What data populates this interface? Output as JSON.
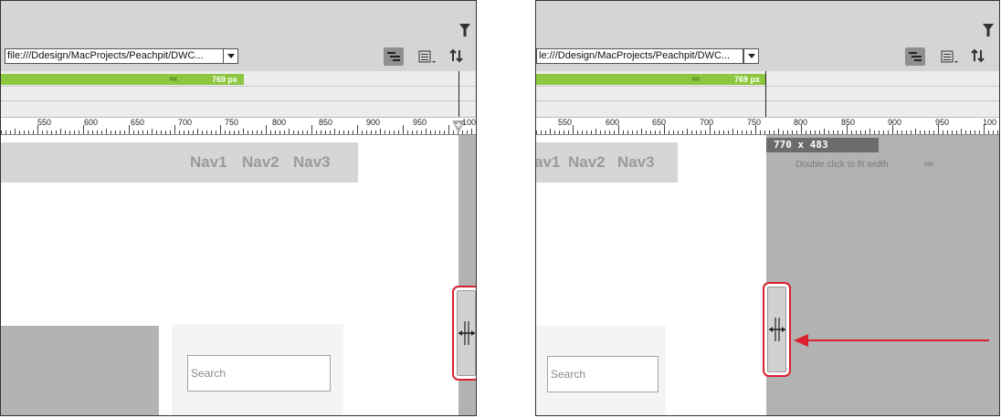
{
  "left": {
    "url": "file:///Ddesign/MacProjects/Peachpit/DWC...",
    "media_query_label": "769 px",
    "media_query_chevrons": "‹‹‹‹‹‹",
    "ruler_numbers": [
      "550",
      "600",
      "650",
      "700",
      "750",
      "800",
      "850",
      "900",
      "950",
      "100"
    ],
    "nav_items": [
      "Nav1",
      "Nav2",
      "Nav3"
    ],
    "search_placeholder": "Search"
  },
  "right": {
    "url": "le:///Ddesign/MacProjects/Peachpit/DWC...",
    "media_query_label": "769 px",
    "media_query_chevrons": "‹‹‹‹‹‹",
    "ruler_numbers": [
      "550",
      "600",
      "650",
      "700",
      "750",
      "800",
      "850",
      "900",
      "950",
      "100"
    ],
    "nav_items": [
      "av1",
      "Nav2",
      "Nav3"
    ],
    "search_placeholder": "Search",
    "size_label": "770 x 483",
    "hint": "Double click to fit width",
    "hint_chevrons": "››››››"
  },
  "icons": [
    "filter-icon",
    "dropdown-arrow-icon",
    "code-navigator-icon",
    "list-view-icon",
    "sort-icon",
    "resize-handle-icon",
    "red-arrow-icon"
  ],
  "colors": {
    "toolbar": "#d5d5d5",
    "media_query_green": "#8dc63f",
    "highlight_red": "#d9202e",
    "overflow_gray": "#b2b2b2"
  }
}
